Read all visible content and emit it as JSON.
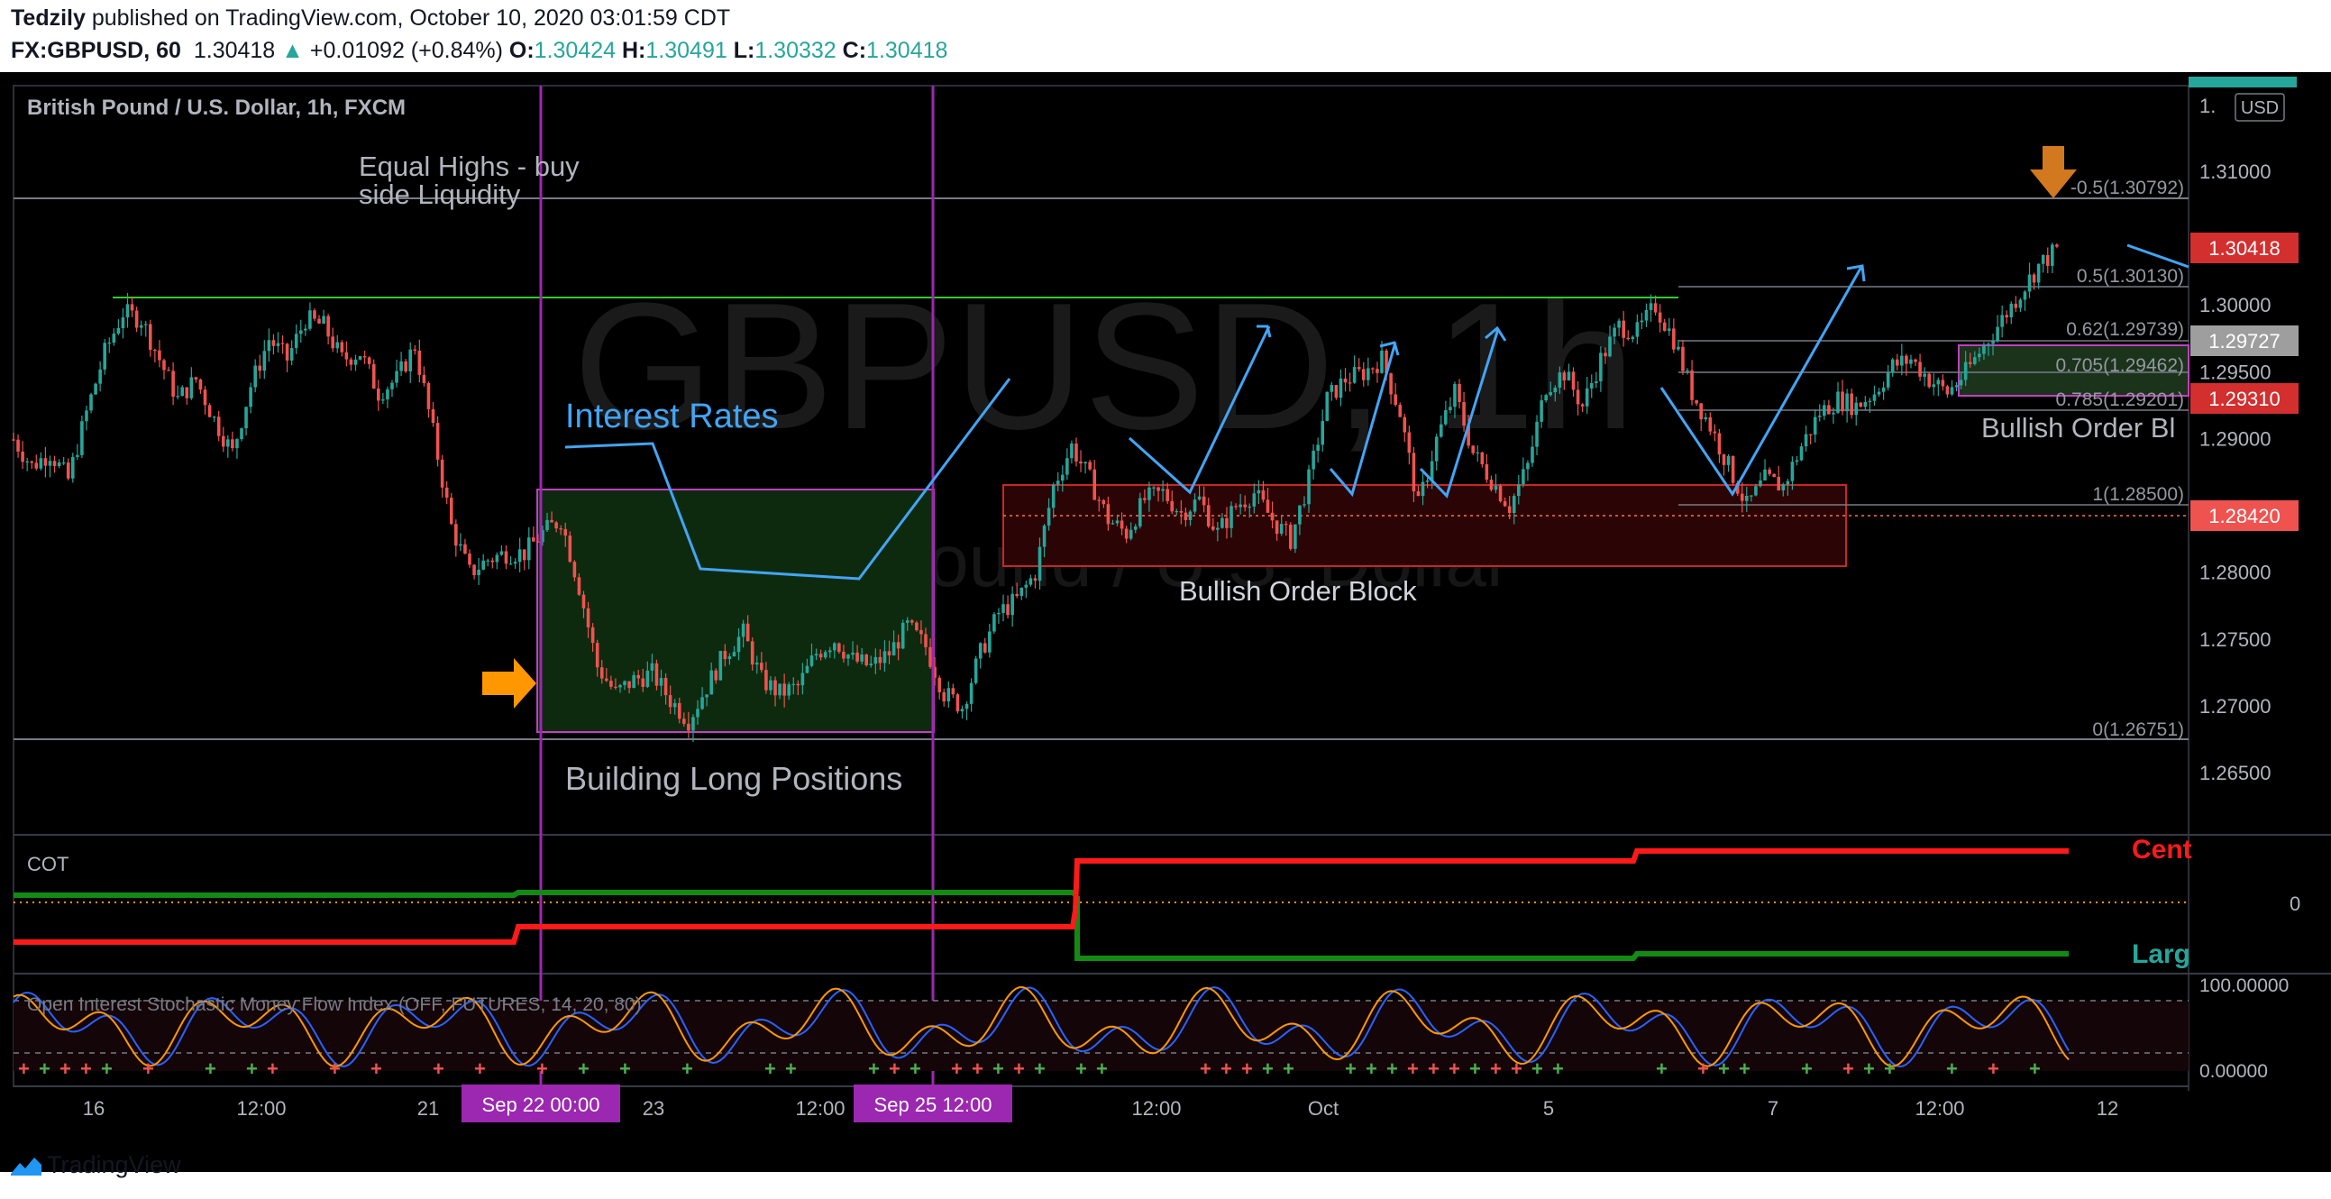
{
  "header": {
    "author": "Tedzily",
    "published_text": "published on TradingView.com, October 10, 2020 03:01:59 CDT",
    "symbol": "FX:GBPUSD, 60",
    "last": "1.30418",
    "up_arrow": "▲",
    "change": "+0.01092 (+0.84%)",
    "o_label": "O:",
    "o_value": "1.30424",
    "h_label": "H:",
    "h_value": "1.30491",
    "l_label": "L:",
    "l_value": "1.30332",
    "c_label": "C:",
    "c_value": "1.30418"
  },
  "chart": {
    "title": "British Pound / U.S. Dollar, 1h, FXCM",
    "watermark_big": "GBPUSD, 1h",
    "watermark_small": "British Pound / U.S. Dollar",
    "currency_label": "USD",
    "annotations": {
      "equal_highs_1": "Equal Highs - buy",
      "equal_highs_2": "side Liquidity",
      "interest_rates": "Interest Rates",
      "building_long": "Building Long Positions",
      "bullish_ob_1": "Bullish Order Block",
      "bullish_ob_2": "Bullish Order Bl"
    },
    "fib_labels": [
      "-0.5(1.30792)",
      "0.5(1.30130)",
      "0.62(1.29739)",
      "0.705(1.29462)",
      "0.785(1.29201)",
      "1(1.28500)",
      "0(1.26751)"
    ],
    "price_tags": [
      "1.30418",
      "1.29727",
      "1.29310",
      "1.28420"
    ],
    "top_tick_partial": "1.",
    "cot_label": "COT",
    "cot_right_red": "Cent",
    "cot_right_green": "Larg",
    "cot_zero": "0",
    "osc_label": "Open Interest Stochastic Money Flow Index (OFF, FUTURES, 14, 20, 80)",
    "osc_ticks": [
      "100.00000",
      "0.00000"
    ],
    "x_ticks": [
      "16",
      "12:00",
      "21",
      "23",
      "12:00",
      "12:00",
      "Oct",
      "5",
      "7",
      "12:00",
      "12"
    ],
    "x_highlights": [
      "Sep 22   00:00",
      "Sep 25   12:00"
    ],
    "colors": {
      "up": "#26a69a",
      "down": "#ef5350",
      "accent_blue": "#2196f3",
      "purple": "#9c27b0",
      "orange": "#ff9800",
      "green_line": "#4caf50"
    }
  },
  "chart_data": {
    "type": "candlestick",
    "title": "British Pound / U.S. Dollar, 1h, FXCM",
    "y_ticks": [
      1.31,
      1.3,
      1.295,
      1.29,
      1.28,
      1.275,
      1.27,
      1.265
    ],
    "y_tick_labels": [
      "1.31000",
      "1.30000",
      "1.29500",
      "1.29000",
      "1.28000",
      "1.27500",
      "1.27000",
      "1.26500"
    ],
    "ylim": [
      1.2595,
      1.3155
    ],
    "levels": [
      {
        "name": "Equal Highs - buy side Liquidity",
        "value": 1.301
      },
      {
        "name": "-0.5",
        "value": 1.30792
      },
      {
        "name": "0.5",
        "value": 1.3013
      },
      {
        "name": "0.62",
        "value": 1.29739
      },
      {
        "name": "0.705",
        "value": 1.29462
      },
      {
        "name": "0.785",
        "value": 1.29201
      },
      {
        "name": "1",
        "value": 1.285
      },
      {
        "name": "0",
        "value": 1.26751
      }
    ],
    "close_path": [
      [
        0,
        1.29
      ],
      [
        4,
        1.288
      ],
      [
        8,
        1.289
      ],
      [
        12,
        1.287
      ],
      [
        16,
        1.292
      ],
      [
        20,
        1.2965
      ],
      [
        24,
        1.2995
      ],
      [
        28,
        1.299
      ],
      [
        32,
        1.296
      ],
      [
        36,
        1.293
      ],
      [
        40,
        1.2945
      ],
      [
        44,
        1.2915
      ],
      [
        48,
        1.289
      ],
      [
        52,
        1.294
      ],
      [
        56,
        1.2975
      ],
      [
        60,
        1.296
      ],
      [
        64,
        1.299
      ],
      [
        68,
        1.2985
      ],
      [
        72,
        1.296
      ],
      [
        76,
        1.2965
      ],
      [
        80,
        1.2935
      ],
      [
        84,
        1.2945
      ],
      [
        88,
        1.297
      ],
      [
        92,
        1.2905
      ],
      [
        96,
        1.2835
      ],
      [
        100,
        1.28
      ],
      [
        104,
        1.281
      ],
      [
        108,
        1.2815
      ],
      [
        112,
        1.2815
      ],
      [
        116,
        1.283
      ],
      [
        120,
        1.284
      ],
      [
        124,
        1.279
      ],
      [
        128,
        1.273
      ],
      [
        132,
        1.271
      ],
      [
        136,
        1.272
      ],
      [
        140,
        1.2725
      ],
      [
        144,
        1.2705
      ],
      [
        148,
        1.269
      ],
      [
        152,
        1.2715
      ],
      [
        156,
        1.274
      ],
      [
        160,
        1.2755
      ],
      [
        164,
        1.272
      ],
      [
        168,
        1.271
      ],
      [
        172,
        1.2715
      ],
      [
        176,
        1.274
      ],
      [
        180,
        1.275
      ],
      [
        184,
        1.2735
      ],
      [
        188,
        1.273
      ],
      [
        192,
        1.274
      ],
      [
        196,
        1.276
      ],
      [
        200,
        1.2745
      ],
      [
        204,
        1.271
      ],
      [
        208,
        1.27
      ],
      [
        212,
        1.274
      ],
      [
        216,
        1.277
      ],
      [
        220,
        1.278
      ],
      [
        224,
        1.28
      ],
      [
        228,
        1.2865
      ],
      [
        232,
        1.2895
      ],
      [
        236,
        1.287
      ],
      [
        240,
        1.284
      ],
      [
        244,
        1.283
      ],
      [
        248,
        1.2855
      ],
      [
        252,
        1.286
      ],
      [
        256,
        1.2845
      ],
      [
        260,
        1.2855
      ],
      [
        264,
        1.283
      ],
      [
        268,
        1.285
      ],
      [
        272,
        1.286
      ],
      [
        276,
        1.284
      ],
      [
        280,
        1.2825
      ],
      [
        284,
        1.287
      ],
      [
        288,
        1.293
      ],
      [
        292,
        1.2945
      ],
      [
        296,
        1.295
      ],
      [
        300,
        1.296
      ],
      [
        304,
        1.292
      ],
      [
        308,
        1.285
      ],
      [
        312,
        1.29
      ],
      [
        316,
        1.2935
      ],
      [
        320,
        1.289
      ],
      [
        324,
        1.287
      ],
      [
        328,
        1.285
      ],
      [
        332,
        1.288
      ],
      [
        336,
        1.294
      ],
      [
        340,
        1.295
      ],
      [
        344,
        1.2925
      ],
      [
        348,
        1.296
      ],
      [
        352,
        1.2985
      ],
      [
        356,
        1.298
      ],
      [
        360,
        1.3
      ],
      [
        364,
        1.2975
      ],
      [
        368,
        1.2935
      ],
      [
        372,
        1.291
      ],
      [
        376,
        1.288
      ],
      [
        380,
        1.285
      ],
      [
        384,
        1.287
      ],
      [
        388,
        1.2865
      ],
      [
        392,
        1.2895
      ],
      [
        396,
        1.292
      ],
      [
        400,
        1.293
      ],
      [
        404,
        1.2925
      ],
      [
        408,
        1.2935
      ],
      [
        412,
        1.2955
      ],
      [
        416,
        1.296
      ],
      [
        420,
        1.2945
      ],
      [
        424,
        1.2935
      ],
      [
        428,
        1.295
      ],
      [
        432,
        1.297
      ],
      [
        436,
        1.299
      ],
      [
        440,
        1.301
      ],
      [
        444,
        1.303
      ],
      [
        448,
        1.3042
      ]
    ],
    "x_tick_labels": [
      "16",
      "12:00",
      "21",
      "Sep 22 00:00",
      "23",
      "12:00",
      "Sep 25 12:00",
      "12:00",
      "Oct",
      "5",
      "7",
      "12:00",
      "12"
    ],
    "zones": [
      {
        "name": "Building Long Positions",
        "from": 1.2675,
        "to": 1.2855
      },
      {
        "name": "Bullish Order Block",
        "from": 1.2805,
        "to": 1.2865
      },
      {
        "name": "Bullish Order Block (right)",
        "from": 1.2932,
        "to": 1.297
      }
    ],
    "cot": {
      "series": [
        {
          "name": "Cent",
          "color": "#ff1a1a",
          "values": [
            -1,
            -1,
            -0.7,
            1,
            1.1
          ]
        },
        {
          "name": "Larg",
          "color": "#138a13",
          "values": [
            0.2,
            0.25,
            0.25,
            -1.2,
            -1.15
          ]
        }
      ],
      "zero": 0
    },
    "oscillator": {
      "name": "Open Interest Stochastic Money Flow Index (OFF, FUTURES, 14, 20, 80)",
      "ylim": [
        0,
        100
      ],
      "levels": [
        20,
        80
      ]
    }
  }
}
